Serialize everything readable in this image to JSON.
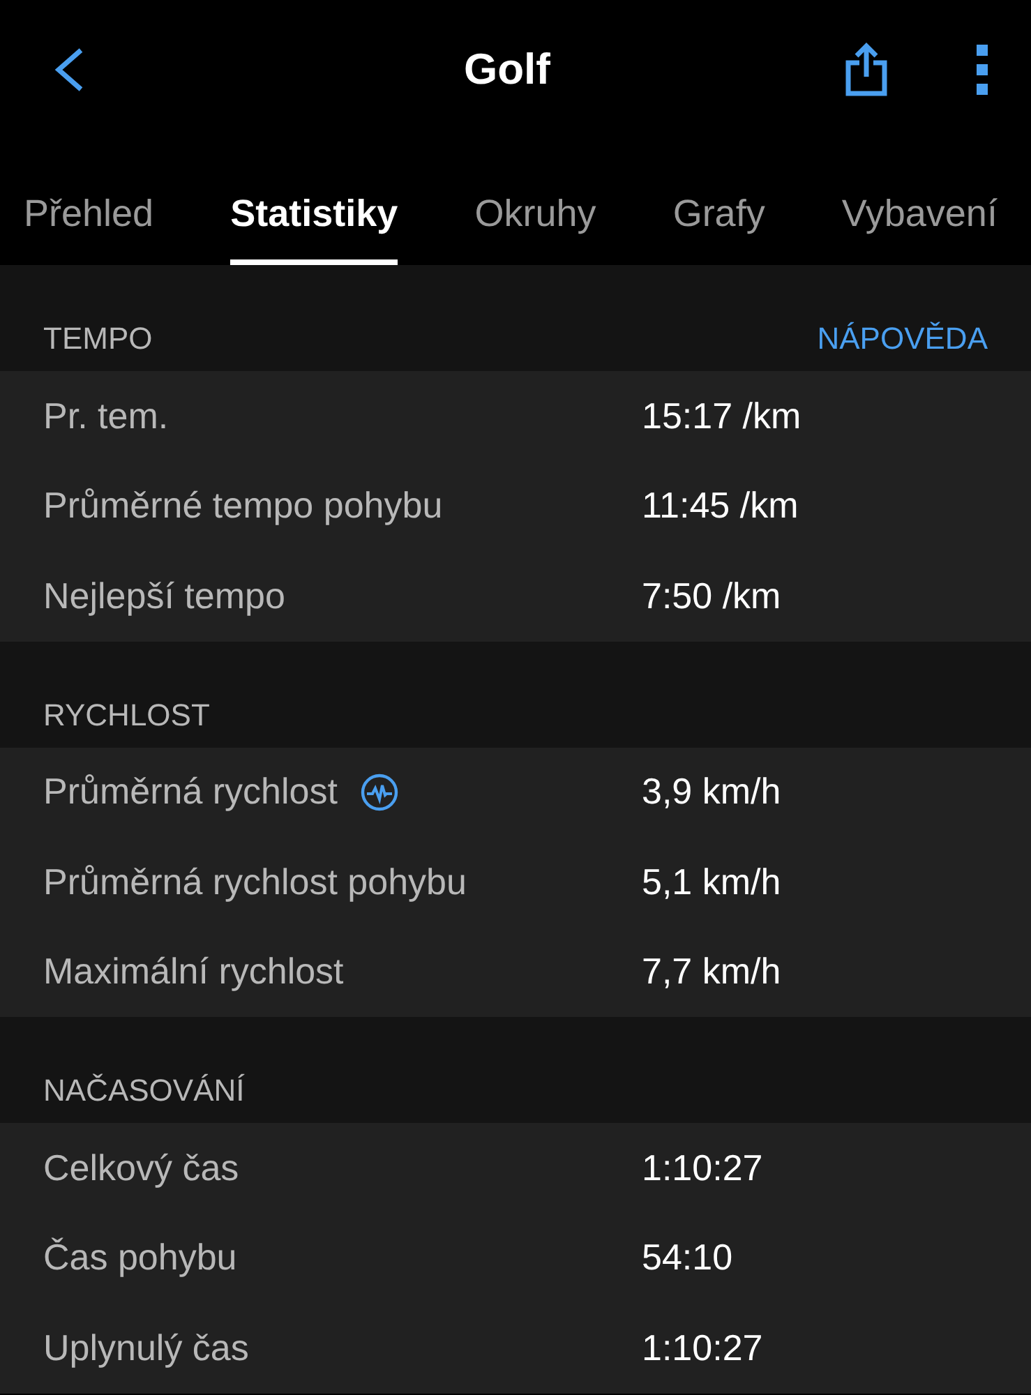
{
  "header": {
    "title": "Golf"
  },
  "tabs": [
    {
      "label": "Přehled",
      "selected": false
    },
    {
      "label": "Statistiky",
      "selected": true
    },
    {
      "label": "Okruhy",
      "selected": false
    },
    {
      "label": "Grafy",
      "selected": false
    },
    {
      "label": "Vybavení",
      "selected": false
    }
  ],
  "sections": [
    {
      "title": "TEMPO",
      "link": "NÁPOVĚDA",
      "rows": [
        {
          "label": "Pr. tem.",
          "value": "15:17 /km",
          "chart_icon": false
        },
        {
          "label": "Průměrné tempo pohybu",
          "value": "11:45 /km",
          "chart_icon": false
        },
        {
          "label": "Nejlepší tempo",
          "value": "7:50 /km",
          "chart_icon": false
        }
      ]
    },
    {
      "title": "RYCHLOST",
      "rows": [
        {
          "label": "Průměrná rychlost",
          "value": "3,9 km/h",
          "chart_icon": true
        },
        {
          "label": "Průměrná rychlost pohybu",
          "value": "5,1 km/h",
          "chart_icon": false
        },
        {
          "label": "Maximální rychlost",
          "value": "7,7 km/h",
          "chart_icon": false
        }
      ]
    },
    {
      "title": "NAČASOVÁNÍ",
      "rows": [
        {
          "label": "Celkový čas",
          "value": "1:10:27",
          "chart_icon": false
        },
        {
          "label": "Čas pohybu",
          "value": "54:10",
          "chart_icon": false
        },
        {
          "label": "Uplynulý čas",
          "value": "1:10:27",
          "chart_icon": false
        }
      ]
    }
  ]
}
